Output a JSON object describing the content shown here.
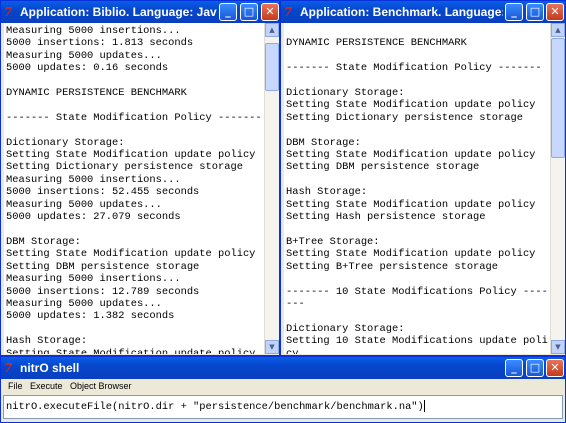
{
  "app_icon": "tcl-feather-icon",
  "left_window": {
    "title": "Application: Biblio. Language: Java. - R...",
    "lines": [
      "Measuring 5000 insertions...",
      "5000 insertions: 1.813 seconds",
      "Measuring 5000 updates...",
      "5000 updates: 0.16 seconds",
      "",
      "DYNAMIC PERSISTENCE BENCHMARK",
      "",
      "------- State Modification Policy -------",
      "",
      "Dictionary Storage:",
      "Setting State Modification update policy",
      "Setting Dictionary persistence storage",
      "Measuring 5000 insertions...",
      "5000 insertions: 52.455 seconds",
      "Measuring 5000 updates...",
      "5000 updates: 27.079 seconds",
      "",
      "DBM Storage:",
      "Setting State Modification update policy",
      "Setting DBM persistence storage",
      "Measuring 5000 insertions...",
      "5000 insertions: 12.789 seconds",
      "Measuring 5000 updates...",
      "5000 updates: 1.382 seconds",
      "",
      "Hash Storage:",
      "Setting State Modification update policy"
    ]
  },
  "right_window": {
    "title": "Application: Benchmark. Language: Java...",
    "lines": [
      "",
      "DYNAMIC PERSISTENCE BENCHMARK",
      "",
      "------- State Modification Policy -------",
      "",
      "Dictionary Storage:",
      "Setting State Modification update policy",
      "Setting Dictionary persistence storage",
      "",
      "DBM Storage:",
      "Setting State Modification update policy",
      "Setting DBM persistence storage",
      "",
      "Hash Storage:",
      "Setting State Modification update policy",
      "Setting Hash persistence storage",
      "",
      "B+Tree Storage:",
      "Setting State Modification update policy",
      "Setting B+Tree persistence storage",
      "",
      "------- 10 State Modifications Policy ----",
      "---",
      "",
      "Dictionary Storage:",
      "Setting 10 State Modifications update poli",
      "cy"
    ]
  },
  "shell_window": {
    "title": "nitrO shell",
    "menu": [
      "File",
      "Execute",
      "Object Browser"
    ],
    "command": "nitrO.executeFile(nitrO.dir + \"persistence/benchmark/benchmark.na\")"
  },
  "buttons": {
    "minimize": "_",
    "maximize": "□",
    "close": "✕"
  },
  "scroll_arrows": {
    "up": "▲",
    "down": "▼"
  },
  "colors": {
    "titlebar": "#0a5de8",
    "close_button": "#c33a1d",
    "console_bg": "#ffffff"
  }
}
